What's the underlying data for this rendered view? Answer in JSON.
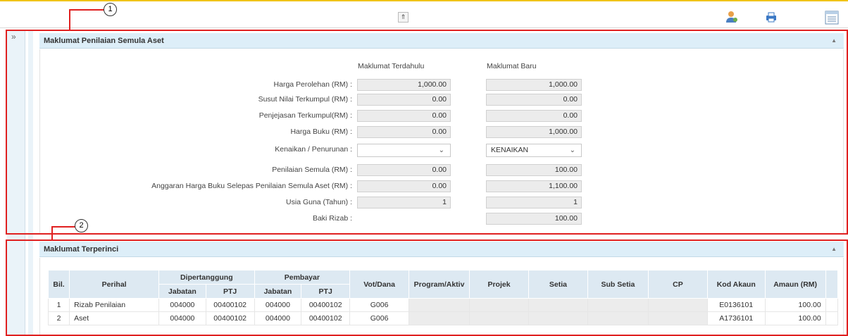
{
  "toolbar": {
    "collapse_icon": "double-chevron-up-icon",
    "icons": [
      "user-settings-icon",
      "printer-icon",
      "list-view-icon"
    ]
  },
  "callouts": [
    "1",
    "2"
  ],
  "rail": {
    "toggle": "»"
  },
  "panel1": {
    "title": "Maklumat Penilaian Semula Aset",
    "col_prev": "Maklumat Terdahulu",
    "col_new": "Maklumat Baru",
    "rows": [
      {
        "label": "Harga Perolehan (RM) :",
        "prev": "1,000.00",
        "new": "1,000.00"
      },
      {
        "label": "Susut Nilai Terkumpul (RM) :",
        "prev": "0.00",
        "new": "0.00"
      },
      {
        "label": "Penjejasan Terkumpul(RM) :",
        "prev": "0.00",
        "new": "0.00"
      },
      {
        "label": "Harga Buku (RM) :",
        "prev": "0.00",
        "new": "1,000.00"
      },
      {
        "label": "Kenaikan / Penurunan :",
        "prev": "",
        "new": "KENAIKAN"
      },
      {
        "label": "Penilaian Semula (RM) :",
        "prev": "0.00",
        "new": "100.00"
      },
      {
        "label": "Anggaran Harga Buku Selepas Penilaian Semula Aset (RM) :",
        "prev": "0.00",
        "new": "1,100.00"
      },
      {
        "label": "Usia Guna (Tahun) :",
        "prev": "1",
        "new": "1"
      },
      {
        "label": "Baki Rizab :",
        "prev": "",
        "new": "100.00"
      }
    ]
  },
  "panel2": {
    "title": "Maklumat Terperinci",
    "headers": {
      "bil": "Bil.",
      "perihal": "Perihal",
      "dipertanggung": "Dipertanggung",
      "pembayar": "Pembayar",
      "jabatan": "Jabatan",
      "ptj": "PTJ",
      "vot": "Vot/Dana",
      "program": "Program/Aktiv",
      "projek": "Projek",
      "setia": "Setia",
      "subsetia": "Sub Setia",
      "cp": "CP",
      "kod": "Kod Akaun",
      "amaun": "Amaun (RM)"
    },
    "rows": [
      {
        "bil": "1",
        "perihal": "Rizab Penilaian",
        "d_jab": "004000",
        "d_ptj": "00400102",
        "p_jab": "004000",
        "p_ptj": "00400102",
        "vot": "G006",
        "kod": "E0136101",
        "amaun": "100.00"
      },
      {
        "bil": "2",
        "perihal": "Aset",
        "d_jab": "004000",
        "d_ptj": "00400102",
        "p_jab": "004000",
        "p_ptj": "00400102",
        "vot": "G006",
        "kod": "A1736101",
        "amaun": "100.00"
      }
    ]
  }
}
